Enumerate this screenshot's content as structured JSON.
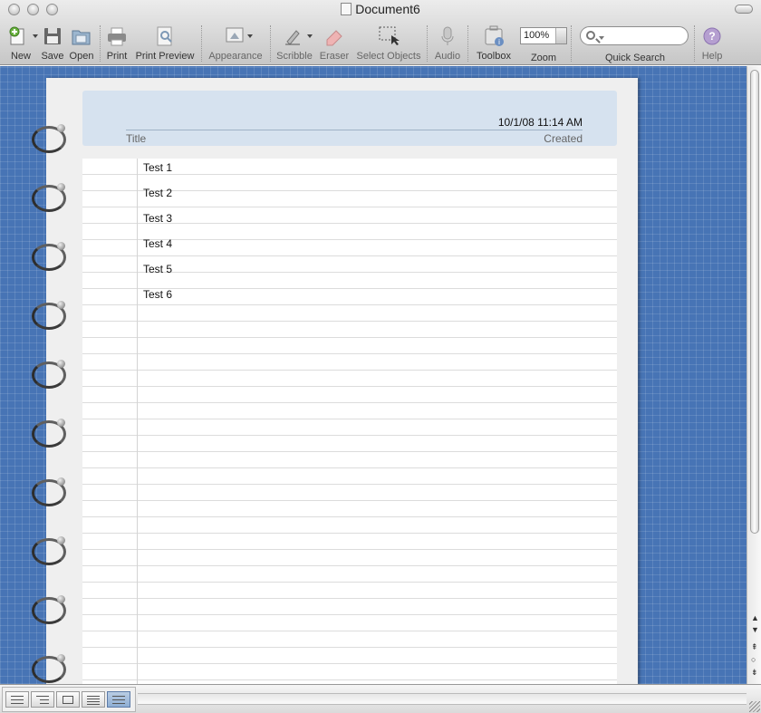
{
  "window": {
    "title": "Document6"
  },
  "toolbar": {
    "new_label": "New",
    "save_label": "Save",
    "open_label": "Open",
    "print_label": "Print",
    "print_preview_label": "Print Preview",
    "appearance_label": "Appearance",
    "scribble_label": "Scribble",
    "eraser_label": "Eraser",
    "select_objects_label": "Select Objects",
    "audio_label": "Audio",
    "toolbox_label": "Toolbox",
    "zoom_label": "Zoom",
    "zoom_value": "100%",
    "quick_search_label": "Quick Search",
    "search_placeholder": "",
    "help_label": "Help"
  },
  "document": {
    "header": {
      "date": "10/1/08 11:14 AM",
      "title_label": "Title",
      "created_label": "Created"
    },
    "rows": [
      {
        "text": "Test 1"
      },
      {
        "text": "Test 2"
      },
      {
        "text": "Test 3"
      },
      {
        "text": "Test 4"
      },
      {
        "text": "Test 5"
      },
      {
        "text": "Test 6"
      }
    ]
  },
  "view_modes": [
    {
      "icon": "outline-view-icon",
      "active": false
    },
    {
      "icon": "indented-view-icon",
      "active": false
    },
    {
      "icon": "layout-view-icon",
      "active": false
    },
    {
      "icon": "document-view-icon",
      "active": false
    },
    {
      "icon": "notebook-view-icon",
      "active": true
    }
  ],
  "colors": {
    "backdrop": "#4774b5",
    "header_fill": "#d6e2ef",
    "active_view": "#8eaed4"
  }
}
